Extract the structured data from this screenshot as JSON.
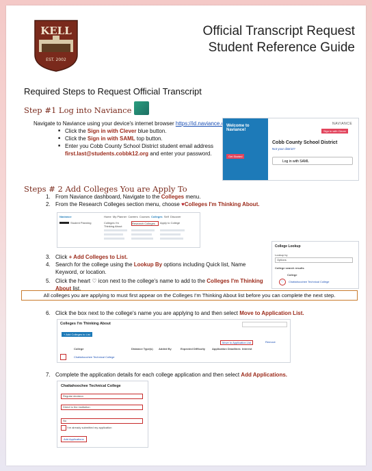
{
  "header": {
    "title_line1": "Official Transcript Request",
    "title_line2": "Student Reference Guide",
    "logo_name": "KELL",
    "logo_est": "EST. 2002"
  },
  "main_heading": "Required Steps to Request Official Transcript",
  "step1": {
    "heading": "Step #1 Log into Naviance",
    "intro": "Navigate to Naviance using your device's internet browser ",
    "url": "https://id.naviance.com/",
    "b1_pre": "Click the ",
    "b1_em": "Sign in with Clever",
    "b1_post": " blue button.",
    "b2_pre": "Click the ",
    "b2_em": "Sign in with SAML",
    "b2_post": " top button.",
    "b3_pre": "Enter you Cobb County School District student email address ",
    "b3_em": "first.last@students.cobbk12.org",
    "b3_post": " and enter your password.",
    "shot": {
      "welcome": "Welcome to Naviance!",
      "brand": "NAVIANCE",
      "district": "Cobb County School District",
      "notyou": "Not your district?",
      "saml": "Log in with SAML",
      "clever_btn": "Sign in with Clever",
      "get_started": "Get Started"
    }
  },
  "step2": {
    "heading": "Steps # 2 Add Colleges You are Apply To",
    "i1_pre": "From Naviance dashboard, Navigate to the ",
    "i1_em": "Colleges",
    "i1_post": " menu.",
    "i2_pre": "From the Research Colleges section menu, choose ",
    "i2_em": "Colleges I'm Thinking About.",
    "i3_pre": "Click ",
    "i3_em": "+ Add Colleges to List.",
    "i4_pre": "Search for the college using the ",
    "i4_em": "Lookup By",
    "i4_post": " options including Quick list, Name Keyword, or location.",
    "i5_pre": "Click the heart ",
    "i5_mid": " icon next to the college's name to add to the ",
    "i5_em": "Colleges I'm Thinking About",
    "i5_post": " list.",
    "lookup": {
      "title": "College Lookup",
      "lookup_by": "Lookup by",
      "select": "Options",
      "results": "College search results",
      "col": "College",
      "item": "Chattahoochee Technical College"
    },
    "nav_shot": {
      "brand": "Naviance",
      "user": "Student Planning",
      "tabs": [
        "Home",
        "My Planner",
        "Careers",
        "Courses",
        "Colleges",
        "Self",
        "Discover"
      ],
      "col1": "Colleges I'm Thinking About",
      "col2": "Research Colleges",
      "col3": "Apply to College"
    }
  },
  "notice": "All colleges you are applying to must first appear on the Colleges I'm Thinking About list before you can complete the next step.",
  "step6": {
    "num": "6.",
    "pre": "Click the box next to the college's name you are applying to and then select ",
    "em": "Move to Application List.",
    "shot": {
      "title": "Colleges I'm Thinking About",
      "add_btn": "+ Add Colleges to List",
      "cols": [
        "College",
        "Distance Type(s)",
        "Added By",
        "Expected Difficulty",
        "Application Deadlines",
        "Interest"
      ],
      "row": "Chattahoochee Technical College",
      "move_btn": "Move to Application List",
      "remove": "Remove"
    }
  },
  "step7": {
    "num": "7.",
    "pre": "Complete the application details for each college application and then select ",
    "em": "Add Applications.",
    "shot": {
      "title": "Chattahoochee Technical College",
      "f1": "Regular decision",
      "f2": "Direct to the institution",
      "f3": "No",
      "check": "I've already submitted my application",
      "btn": "Add Applications"
    }
  },
  "colors": {
    "accent_red": "#9b2a1a",
    "step_heading": "#7a2a1c",
    "link": "#1a4fb5",
    "notice_border": "#c97a2c"
  }
}
